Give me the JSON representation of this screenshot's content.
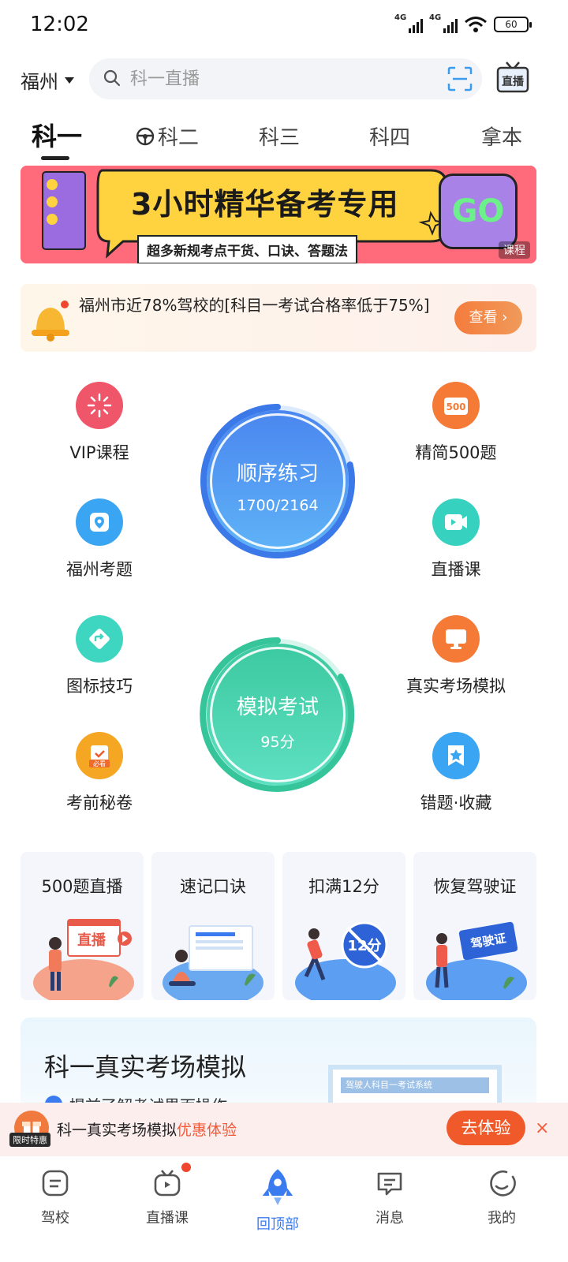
{
  "status_bar": {
    "time": "12:02",
    "network1": "4G",
    "network2": "4G",
    "battery": "60"
  },
  "header": {
    "city": "福州",
    "search_placeholder": "科一直播",
    "live_label": "直播"
  },
  "tabs": [
    {
      "label": "科一",
      "active": true
    },
    {
      "label": "科二",
      "active": false
    },
    {
      "label": "科三",
      "active": false
    },
    {
      "label": "科四",
      "active": false
    },
    {
      "label": "拿本",
      "active": false
    }
  ],
  "banner": {
    "title": "3小时精华备考专用",
    "subtitle": "超多新规考点干货、口诀、答题法",
    "go_label": "GO",
    "tag": "课程"
  },
  "notice": {
    "text": "福州市近78%驾校的[科目一考试合格率低于75%]",
    "button": "查看 ›"
  },
  "features": {
    "left": [
      {
        "label": "VIP课程",
        "icon": "sparkle-icon",
        "color": "#f0566a"
      },
      {
        "label": "福州考题",
        "icon": "location-icon",
        "color": "#3aa5f2"
      },
      {
        "label": "图标技巧",
        "icon": "direction-sign-icon",
        "color": "#3ed6c0"
      },
      {
        "label": "考前秘卷",
        "icon": "clipboard-icon",
        "color": "#f5a623"
      }
    ],
    "right": [
      {
        "label": "精简500题",
        "icon": "500-badge-icon",
        "color": "#f47a36"
      },
      {
        "label": "直播课",
        "icon": "video-icon",
        "color": "#37d2bf"
      },
      {
        "label": "真实考场模拟",
        "icon": "monitor-icon",
        "color": "#f47a36"
      },
      {
        "label": "错题·收藏",
        "icon": "star-bookmark-icon",
        "color": "#3aa5f2"
      }
    ],
    "practice": {
      "title": "顺序练习",
      "progress": "1700/2164",
      "done": 1700,
      "total": 2164
    },
    "exam": {
      "title": "模拟考试",
      "score": "95分"
    }
  },
  "cards": [
    {
      "title": "500题直播",
      "art": "直播"
    },
    {
      "title": "速记口诀",
      "art": ""
    },
    {
      "title": "扣满12分",
      "art": "12分"
    },
    {
      "title": "恢复驾驶证",
      "art": "驾驶证"
    }
  ],
  "promo": {
    "title": "科一真实考场模拟",
    "subtitle": "提前了解考试界面操作",
    "screen_text": "驾驶人科目一考试系统"
  },
  "offer_bar": {
    "badge": "限时特惠",
    "text": "科一真实考场模拟",
    "accent": "优惠体验",
    "button": "去体验",
    "close": "×"
  },
  "bottom_nav": [
    {
      "label": "驾校",
      "icon": "school-icon",
      "active": false
    },
    {
      "label": "直播课",
      "icon": "tv-icon",
      "active": false
    },
    {
      "label": "回顶部",
      "icon": "rocket-icon",
      "active": true
    },
    {
      "label": "消息",
      "icon": "message-icon",
      "active": false
    },
    {
      "label": "我的",
      "icon": "smile-icon",
      "active": false
    }
  ],
  "colors": {
    "accent_blue": "#3a7bef",
    "accent_orange": "#f05a2a",
    "practice_blue": "#4a90f0",
    "exam_green": "#3fd1a6"
  }
}
